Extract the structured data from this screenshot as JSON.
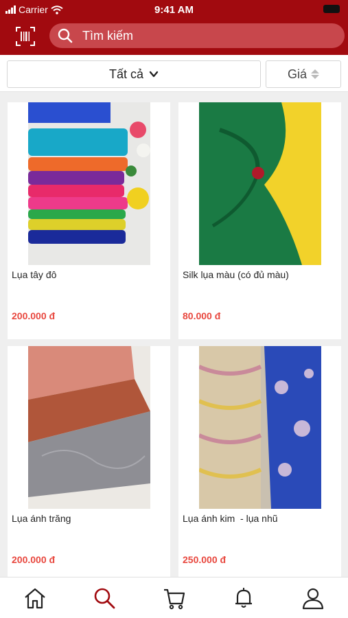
{
  "status_bar": {
    "carrier": "Carrier",
    "time": "9:41 AM"
  },
  "header": {
    "scan_icon": "barcode-scan-icon",
    "search_icon": "search-icon",
    "search_placeholder": "Tìm kiếm"
  },
  "filters": {
    "category_label": "Tất cả",
    "price_label": "Giá"
  },
  "products": [
    {
      "name": "Lụa tây đô",
      "price": "200.000 đ"
    },
    {
      "name": "Silk lụa màu (có đủ màu)",
      "price": "80.000 đ"
    },
    {
      "name": "Lụa ánh trăng",
      "price": "200.000 đ"
    },
    {
      "name": "Lụa ánh kim  - lụa nhũ",
      "price": "250.000 đ"
    }
  ],
  "tabbar": {
    "items": [
      "home-icon",
      "search-icon",
      "cart-icon",
      "bell-icon",
      "user-icon"
    ],
    "active": "search-icon"
  },
  "colors": {
    "brand": "#a10a0f",
    "price": "#e8473e",
    "active_tab": "#a10a0f"
  }
}
